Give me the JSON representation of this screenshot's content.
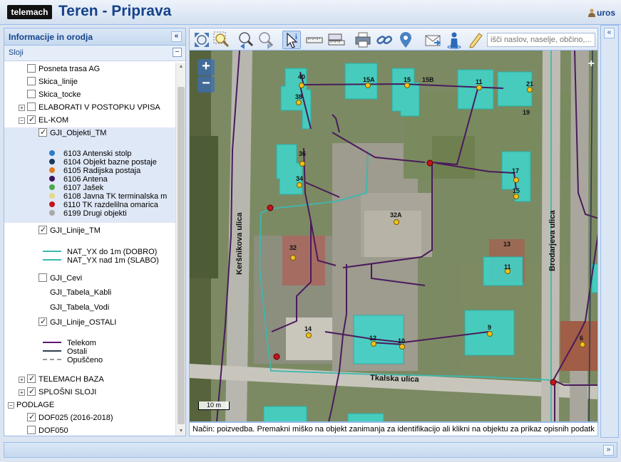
{
  "header": {
    "logo": "telemach",
    "title": "Teren - Priprava",
    "user": "uros"
  },
  "left_panel": {
    "title": "Informacije in orodja",
    "collapse_symbol": "«",
    "layers_label": "Sloji",
    "layers_toggle": "−",
    "tree": [
      {
        "label": "Posneta trasa AG",
        "checked": false
      },
      {
        "label": "Skica_linije",
        "checked": false
      },
      {
        "label": "Skica_tocke",
        "checked": false
      },
      {
        "label": "ELABORATI V POSTOPKU VPISA",
        "checked": false,
        "expander": "+"
      },
      {
        "label": "EL-KOM",
        "checked": true,
        "expander": "−"
      },
      {
        "label": "GJI_Objekti_TM",
        "checked": true
      },
      {
        "label": "GJI_Linije_TM",
        "checked": true
      },
      {
        "label": "GJI_Cevi",
        "checked": false
      },
      {
        "label": "GJI_Tabela_Kabli"
      },
      {
        "label": "GJI_Tabela_Vodi"
      },
      {
        "label": "GJI_Linije_OSTALI",
        "checked": true
      },
      {
        "label": "TELEMACH BAZA",
        "checked": true,
        "expander": "+"
      },
      {
        "label": "SPLOŠNI SLOJI",
        "checked": true,
        "expander": "+"
      },
      {
        "label": "PODLAGE",
        "expander": "−"
      },
      {
        "label": "DOF025 (2016-2018)",
        "checked": true
      },
      {
        "label": "DOF050",
        "checked": false
      }
    ],
    "objekti_legend": [
      {
        "label": "6103 Antenski stolp",
        "color": "#2f7cc7"
      },
      {
        "label": "6104 Objekt bazne postaje",
        "color": "#1b3a5c"
      },
      {
        "label": "6105 Radijska postaja",
        "color": "#e07b22"
      },
      {
        "label": "6106 Antena",
        "color": "#3d1160"
      },
      {
        "label": "6107 Jašek",
        "color": "#4aa84a"
      },
      {
        "label": "6108 Javna TK terminalska m",
        "color": "#e8d88a"
      },
      {
        "label": "6110 TK razdelilna omarica",
        "color": "#c4141c"
      },
      {
        "label": "6199 Drugi objekti",
        "color": "#a9a9a9"
      }
    ],
    "linije_legend": [
      {
        "label": "NAT_YX do 1m (DOBRO)",
        "color": "#3ab9b0"
      },
      {
        "label": "NAT_YX nad 1m (SLABO)",
        "color": "#3ab9b0"
      }
    ],
    "ostali_legend": [
      {
        "label": "Telekom",
        "color": "#5a1a6e"
      },
      {
        "label": "Ostali",
        "color": "#2d3e50"
      },
      {
        "label": "Opuščeno",
        "color": "#9a9a9a"
      }
    ]
  },
  "toolbar": {
    "search_placeholder": "išči naslov, naselje, občino,..."
  },
  "map": {
    "zoom_in": "+",
    "zoom_out": "−",
    "scale": "10 m",
    "corner": "+",
    "street_1": "Keršnikova ulica",
    "street_2": "Brodarjeva ulica",
    "street_3": "Tkalska ulica",
    "buildings": [
      "40",
      "38",
      "15A",
      "15",
      "15B",
      "11",
      "21",
      "19",
      "36",
      "34",
      "17",
      "15",
      "32A",
      "32",
      "13",
      "11",
      "14",
      "12",
      "10",
      "9",
      "6"
    ]
  },
  "status": {
    "text": "Način: poizvedba. Premakni miško na objekt zanimanja za identifikacijo ali klikni na objektu za prikaz opisnih podatk"
  },
  "right_panel": {
    "expand_symbol": "«"
  },
  "bottom_panel": {
    "expand_symbol": "»"
  }
}
